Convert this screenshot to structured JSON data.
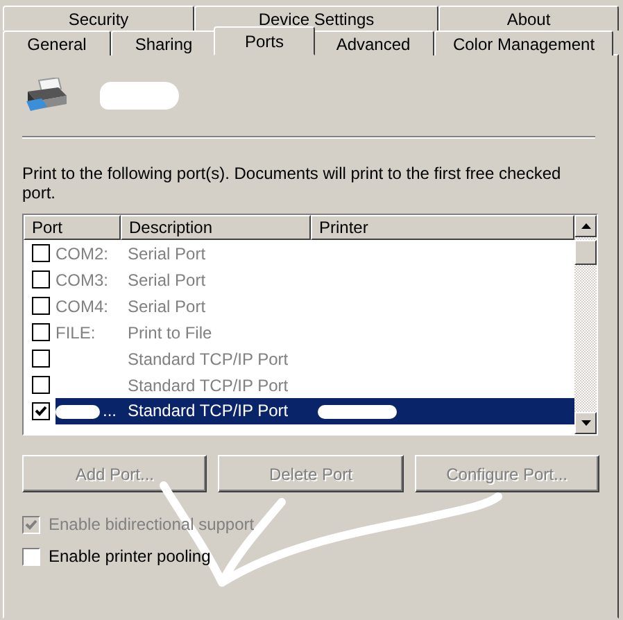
{
  "tabs_back_row": [
    {
      "label": "Security",
      "selected": false
    },
    {
      "label": "Device Settings",
      "selected": false
    },
    {
      "label": "About",
      "selected": false
    }
  ],
  "tabs": [
    {
      "label": "General",
      "selected": false
    },
    {
      "label": "Sharing",
      "selected": false
    },
    {
      "label": "Ports",
      "selected": true
    },
    {
      "label": "Advanced",
      "selected": false
    },
    {
      "label": "Color Management",
      "selected": false
    }
  ],
  "printer": {
    "name_redacted": true
  },
  "instructions": "Print to the following port(s). Documents will print to the first free checked port.",
  "port_list": {
    "columns": [
      "Port",
      "Description",
      "Printer"
    ],
    "rows": [
      {
        "port": "COM2:",
        "description": "Serial Port",
        "checked": false,
        "selected": false
      },
      {
        "port": "COM3:",
        "description": "Serial Port",
        "checked": false,
        "selected": false
      },
      {
        "port": "COM4:",
        "description": "Serial Port",
        "checked": false,
        "selected": false
      },
      {
        "port": "FILE:",
        "description": "Print to File",
        "checked": false,
        "selected": false
      },
      {
        "description": "Standard TCP/IP Port",
        "checked": false,
        "selected": false
      },
      {
        "description": "Standard TCP/IP Port",
        "checked": false,
        "selected": false
      },
      {
        "port": "...",
        "port_redacted": true,
        "description": "Standard TCP/IP Port",
        "printer_redacted": true,
        "checked": true,
        "selected": true
      }
    ]
  },
  "buttons": [
    {
      "label": "Add Port...",
      "disabled": true
    },
    {
      "label": "Delete Port",
      "disabled": true
    },
    {
      "label": "Configure Port...",
      "disabled": true
    }
  ],
  "options": [
    {
      "label": "Enable bidirectional support",
      "checked": true,
      "disabled": true
    },
    {
      "label": "Enable printer pooling",
      "checked": false,
      "disabled": false
    }
  ]
}
